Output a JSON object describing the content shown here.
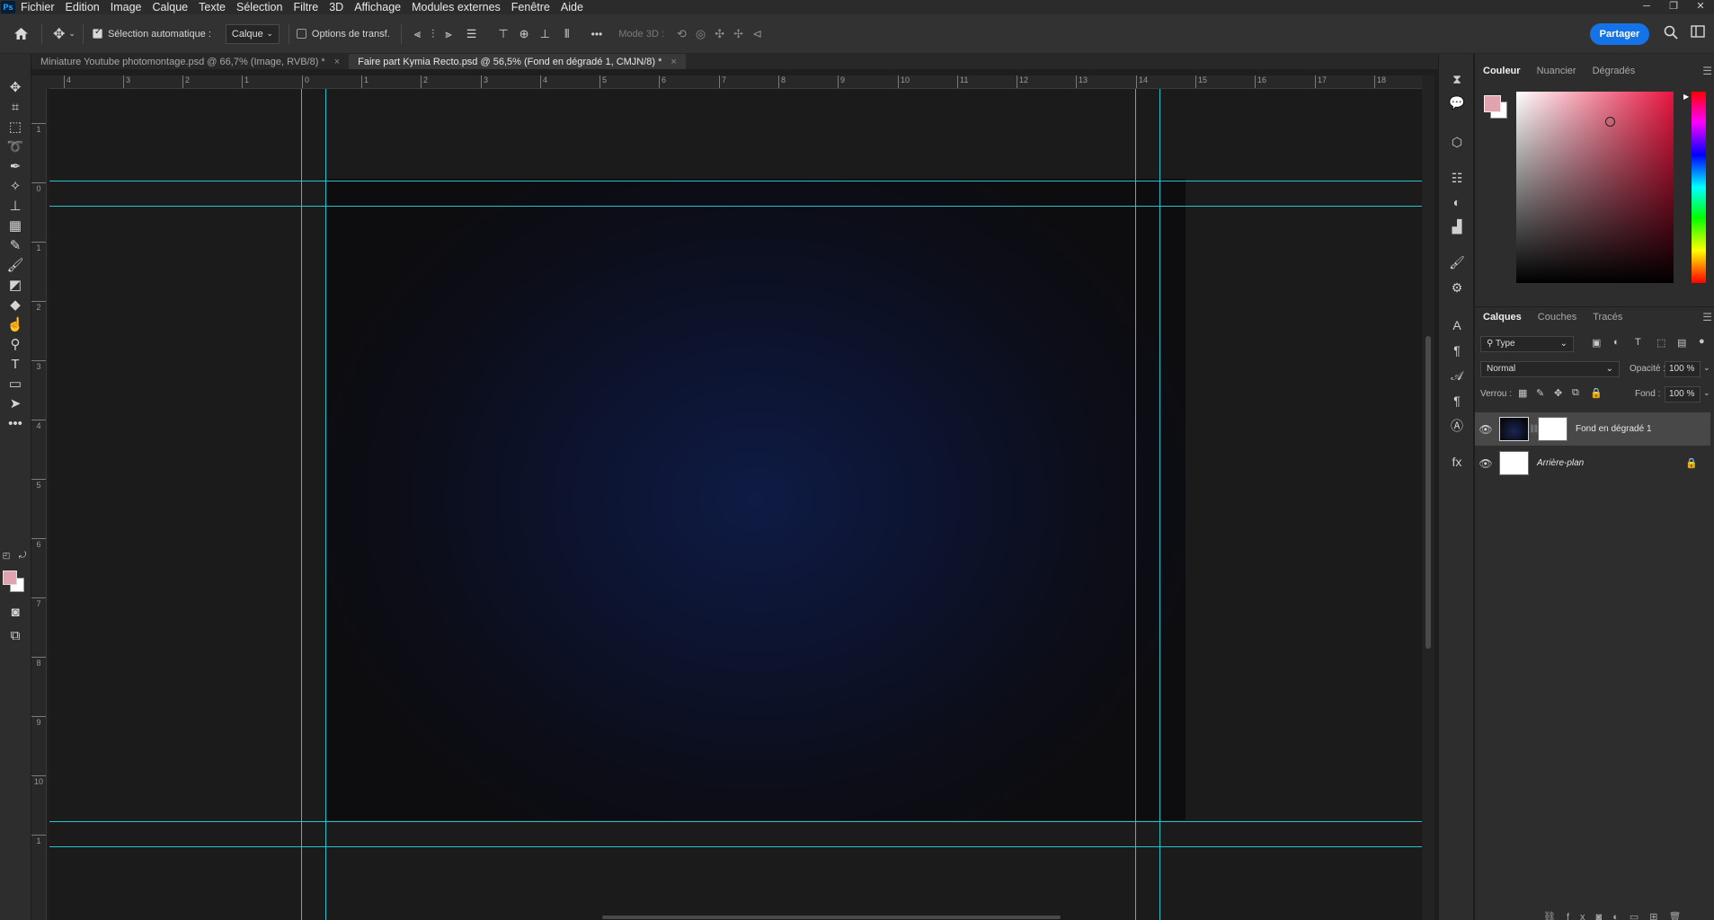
{
  "app": {
    "logo": "Ps"
  },
  "menu": [
    "Fichier",
    "Edition",
    "Image",
    "Calque",
    "Texte",
    "Sélection",
    "Filtre",
    "3D",
    "Affichage",
    "Modules externes",
    "Fenêtre",
    "Aide"
  ],
  "window_controls": {
    "minimize": "─",
    "restore": "❐",
    "close": "✕"
  },
  "options_bar": {
    "auto_select_label": "Sélection automatique :",
    "auto_select_checked": true,
    "auto_select_value": "Calque",
    "transform_label": "Options de transf.",
    "transform_checked": false,
    "mode3d_label": "Mode 3D :",
    "more": "•••",
    "share_label": "Partager"
  },
  "tabs": [
    {
      "label": "Miniature Youtube photomontage.psd @ 66,7% (Image, RVB/8) *",
      "active": false,
      "close": "×"
    },
    {
      "label": "Faire part Kymia Recto.psd @ 56,5% (Fond en dégradé 1, CMJN/8) *",
      "active": true,
      "close": "×"
    }
  ],
  "ruler_h_labels": [
    "4",
    "3",
    "2",
    "1",
    "0",
    "1",
    "2",
    "3",
    "4",
    "5",
    "6",
    "7",
    "8",
    "9",
    "10",
    "11",
    "12",
    "13",
    "14",
    "15",
    "16",
    "17",
    "18"
  ],
  "ruler_v_labels": [
    "1",
    "0",
    "1",
    "2",
    "3",
    "4",
    "5",
    "6",
    "7",
    "8",
    "9",
    "10",
    "1"
  ],
  "colors": {
    "foreground": "#e1a3ad",
    "background": "#ffffff",
    "guide": "#27c3cc",
    "accent": "#1473e6"
  },
  "color_panel": {
    "tabs": [
      "Couleur",
      "Nuancier",
      "Dégradés"
    ]
  },
  "layers_panel": {
    "tabs": [
      "Calques",
      "Couches",
      "Tracés"
    ],
    "filter_label": "Type",
    "blend_mode": "Normal",
    "opacity_label": "Opacité :",
    "opacity_value": "100 %",
    "lock_label": "Verrou :",
    "fill_label": "Fond :",
    "fill_value": "100 %",
    "layers": [
      {
        "name": "Fond en dégradé 1",
        "visible": true,
        "selected": true,
        "italic": false,
        "locked": false
      },
      {
        "name": "Arrière-plan",
        "visible": true,
        "selected": false,
        "italic": true,
        "locked": true
      }
    ]
  }
}
